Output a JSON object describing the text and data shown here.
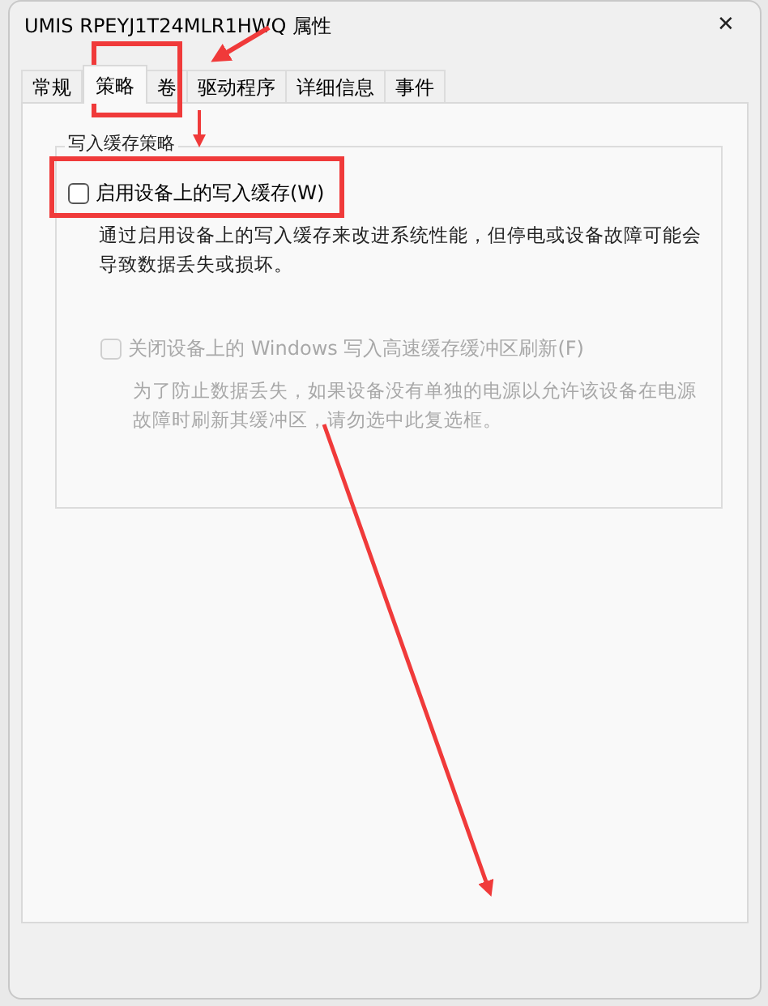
{
  "window": {
    "title": "UMIS RPEYJ1T24MLR1HWQ 属性",
    "close": "✕"
  },
  "tabs": [
    {
      "label": "常规",
      "selected": false
    },
    {
      "label": "策略",
      "selected": true
    },
    {
      "label": "卷",
      "selected": false
    },
    {
      "label": "驱动程序",
      "selected": false
    },
    {
      "label": "详细信息",
      "selected": false
    },
    {
      "label": "事件",
      "selected": false
    }
  ],
  "group": {
    "title": "写入缓存策略",
    "options": [
      {
        "label": "启用设备上的写入缓存(W)",
        "checked": false,
        "disabled": false,
        "description": "通过启用设备上的写入缓存来改进系统性能，但停电或设备故障可能会导致数据丢失或损坏。"
      },
      {
        "label": "关闭设备上的 Windows 写入高速缓存缓冲区刷新(F)",
        "checked": false,
        "disabled": true,
        "description": "为了防止数据丢失，如果设备没有单独的电源以允许该设备在电源故障时刷新其缓冲区，请勿选中此复选框。"
      }
    ]
  }
}
